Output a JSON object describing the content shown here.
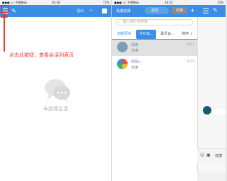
{
  "left_phone": {
    "status": {
      "carrier": "●●●○○ 中国移动",
      "time": "16:18",
      "battery": "72%"
    },
    "nav": {
      "link1": "退出",
      "link2": "⚠"
    },
    "annotation": "点击此按钮，查看会话列表页",
    "empty_state": "未选择会话"
  },
  "right_phone": {
    "status": {
      "carrier": "●●●○○ 中国移动",
      "time": "16:22",
      "battery": "72%"
    },
    "nav": {
      "title": "批量选择",
      "pill_text": "在线",
      "grey_btn": "切换",
      "plus": "+"
    },
    "search": {
      "placeholder": "输入用户名搜索"
    },
    "tabs": {
      "load_more": "加载更多",
      "today": "今日会...",
      "recent": "最近会...",
      "sort": "排序 ↓"
    },
    "sessions": [
      {
        "name": "网络",
        "time": "16:21",
        "sub": "坐席"
      },
      {
        "name": "明明n",
        "time": "16:20",
        "sub": "坐席"
      }
    ],
    "edge": {
      "send": "快捷"
    }
  },
  "colors": {
    "brand": "#3a8ee6",
    "annotation": "#e63a2e"
  }
}
